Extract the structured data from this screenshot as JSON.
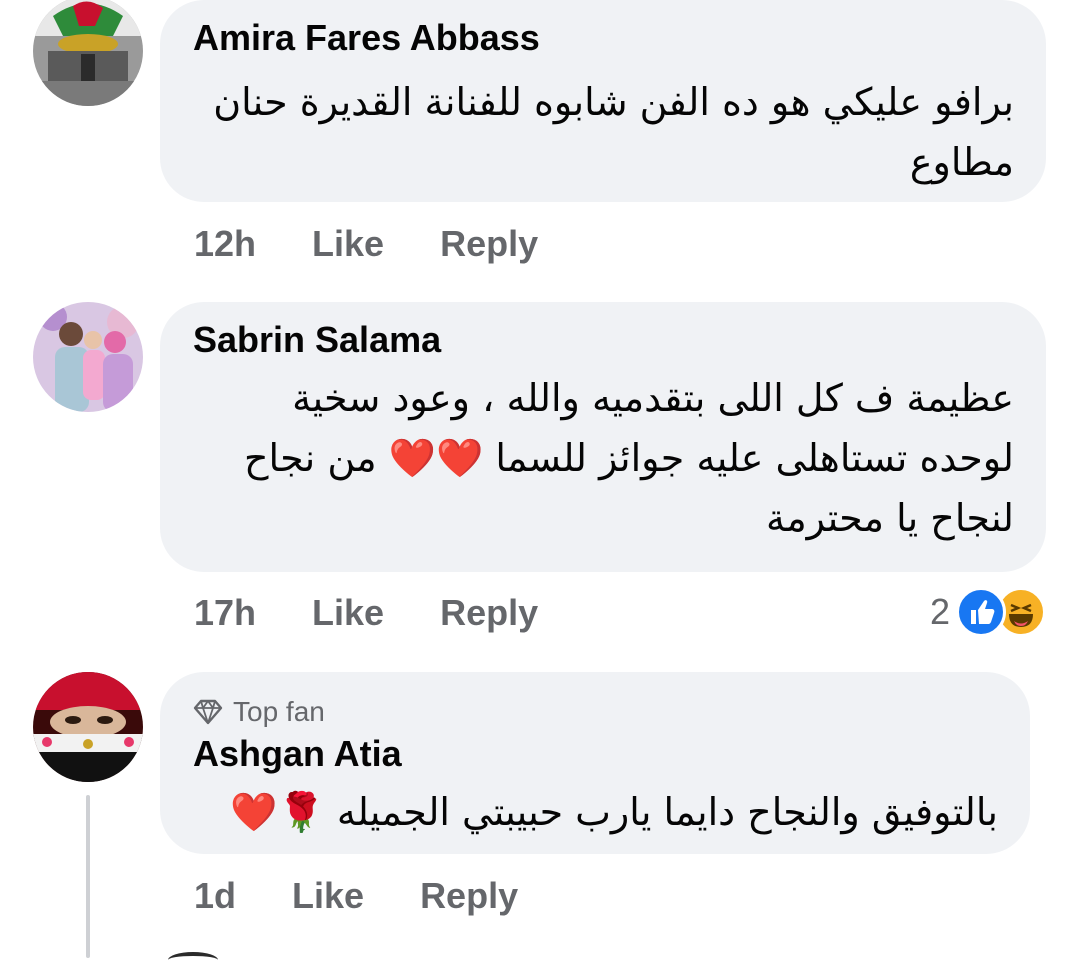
{
  "comments": [
    {
      "author": "Amira Fares Abbass",
      "text": "برافو عليكي هو ده الفن شابوه للفنانة القديرة حنان مطاوع",
      "time": "12h",
      "like": "Like",
      "reply": "Reply"
    },
    {
      "author": "Sabrin Salama",
      "text": "عظيمة ف كل اللى بتقدميه والله ، وعود سخية لوحده تستاهلى عليه جوائز للسما ❤️❤️ من نجاح لنجاح يا محترمة",
      "time": "17h",
      "like": "Like",
      "reply": "Reply",
      "reaction_count": "2",
      "reaction_icons": [
        "like-icon",
        "haha-icon"
      ]
    },
    {
      "badge": "Top fan",
      "author": "Ashgan Atia",
      "text": "بالتوفيق والنجاح دايما يارب حبيبتي الجميله 🌹❤️",
      "time": "1d",
      "like": "Like",
      "reply": "Reply"
    }
  ],
  "colors": {
    "bubble": "#f0f2f5",
    "meta_text": "#65676b",
    "like_blue": "#1877f2",
    "haha_yellow": "#f7b125",
    "heart_red": "#e0245e"
  }
}
